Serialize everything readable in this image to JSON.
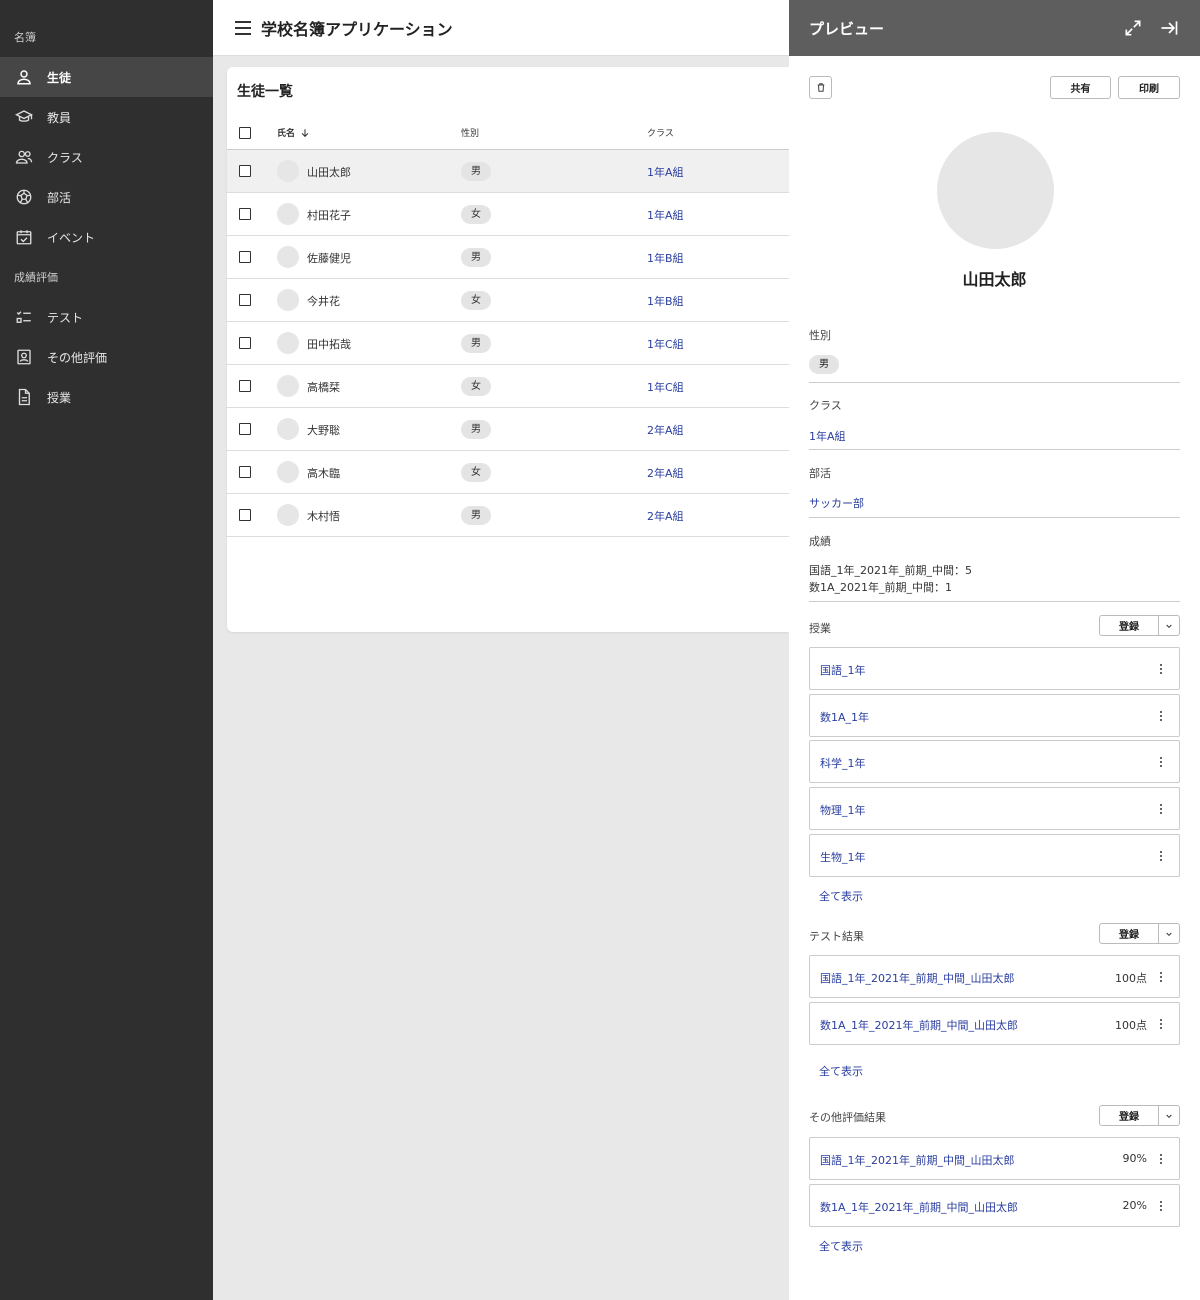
{
  "sidebar": {
    "section1": "名簿",
    "items1": [
      {
        "label": "生徒",
        "icon": "person-icon"
      },
      {
        "label": "教員",
        "icon": "mortarboard-icon"
      },
      {
        "label": "クラス",
        "icon": "group-icon"
      },
      {
        "label": "部活",
        "icon": "ball-icon"
      },
      {
        "label": "イベント",
        "icon": "calendar-check-icon"
      }
    ],
    "section2": "成績評価",
    "items2": [
      {
        "label": "テスト",
        "icon": "checklist-icon"
      },
      {
        "label": "その他評価",
        "icon": "badge-icon"
      },
      {
        "label": "授業",
        "icon": "document-icon"
      }
    ]
  },
  "header": {
    "title": "学校名簿アプリケーション"
  },
  "list": {
    "title": "生徒一覧",
    "columns": {
      "name": "氏名",
      "gender": "性別",
      "class": "クラス"
    },
    "rows": [
      {
        "name": "山田太郎",
        "gender": "男",
        "class": "1年A組"
      },
      {
        "name": "村田花子",
        "gender": "女",
        "class": "1年A組"
      },
      {
        "name": "佐藤健児",
        "gender": "男",
        "class": "1年B組"
      },
      {
        "name": "今井花",
        "gender": "女",
        "class": "1年B組"
      },
      {
        "name": "田中拓哉",
        "gender": "男",
        "class": "1年C組"
      },
      {
        "name": "高橋栞",
        "gender": "女",
        "class": "1年C組"
      },
      {
        "name": "大野聡",
        "gender": "男",
        "class": "2年A組"
      },
      {
        "name": "高木臨",
        "gender": "女",
        "class": "2年A組"
      },
      {
        "name": "木村悟",
        "gender": "男",
        "class": "2年A組"
      }
    ]
  },
  "preview": {
    "title": "プレビュー",
    "share": "共有",
    "print": "印刷",
    "name": "山田太郎",
    "gender_label": "性別",
    "gender": "男",
    "class_label": "クラス",
    "class": "1年A組",
    "club_label": "部活",
    "club": "サッカー部",
    "grades_label": "成績",
    "grades": [
      "国語_1年_2021年_前期_中間：5",
      "数1A_2021年_前期_中間：1"
    ],
    "register": "登録",
    "show_all": "全て表示",
    "classes_label": "授業",
    "classes": [
      "国語_1年",
      "数1A_1年",
      "科学_1年",
      "物理_1年",
      "生物_1年"
    ],
    "tests_label": "テスト結果",
    "tests": [
      {
        "name": "国語_1年_2021年_前期_中間_山田太郎",
        "score": "100点"
      },
      {
        "name": "数1A_1年_2021年_前期_中間_山田太郎",
        "score": "100点"
      }
    ],
    "others_label": "その他評価結果",
    "others": [
      {
        "name": "国語_1年_2021年_前期_中間_山田太郎",
        "score": "90%"
      },
      {
        "name": "数1A_1年_2021年_前期_中間_山田太郎",
        "score": "20%"
      }
    ]
  }
}
